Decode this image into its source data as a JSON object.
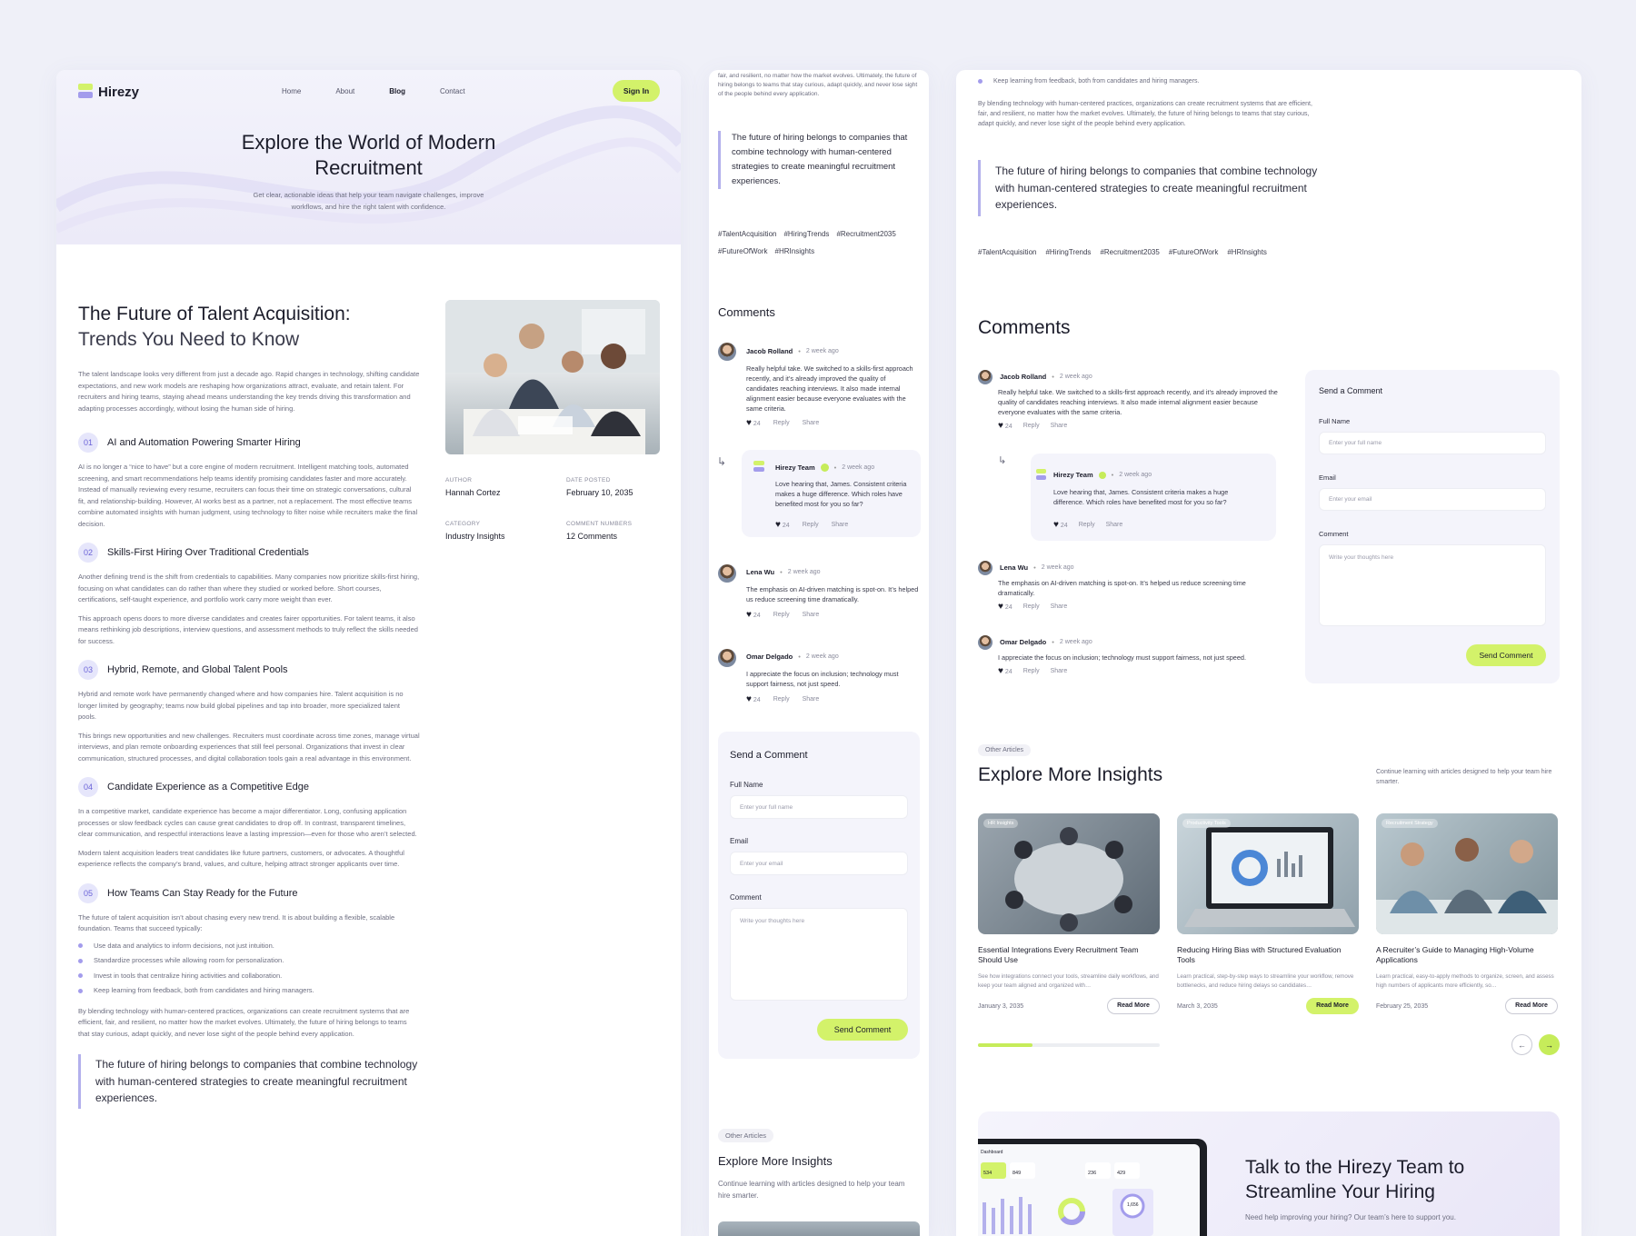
{
  "brand": {
    "name": "Hirezy",
    "colors": {
      "accent": "#d3f26a",
      "purple": "#a39cec",
      "bg": "#eff0f8"
    }
  },
  "nav": {
    "items": [
      "Home",
      "About",
      "Blog",
      "Contact"
    ],
    "active": "Blog",
    "signin": "Sign In"
  },
  "hero": {
    "title_line1": "Explore the World of Modern",
    "title_line2": "Recruitment",
    "subtitle_line1": "Get clear, actionable ideas that help your team navigate challenges, improve",
    "subtitle_line2": "workflows, and hire the right talent with confidence."
  },
  "article": {
    "title_line1": "The Future of Talent Acquisition:",
    "title_line2": "Trends You Need to Know",
    "intro": "The talent landscape looks very different from just a decade ago. Rapid changes in technology, shifting candidate expectations, and new work models are reshaping how organizations attract, evaluate, and retain talent. For recruiters and hiring teams, staying ahead means understanding the key trends driving this transformation and adapting processes accordingly, without losing the human side of hiring.",
    "meta": {
      "author_label": "AUTHOR",
      "author": "Hannah Cortez",
      "date_label": "DATE POSTED",
      "date": "February 10, 2035",
      "category_label": "CATEGORY",
      "category": "Industry Insights",
      "comments_label": "COMMENT NUMBERS",
      "comments": "12 Comments"
    },
    "sections": [
      {
        "num": "01",
        "title": "AI and Automation Powering Smarter Hiring",
        "paragraphs": [
          "AI is no longer a “nice to have” but a core engine of modern recruitment. Intelligent matching tools, automated screening, and smart recommendations help teams identify promising candidates faster and more accurately. Instead of manually reviewing every resume, recruiters can focus their time on strategic conversations, cultural fit, and relationship-building. However, AI works best as a partner, not a replacement. The most effective teams combine automated insights with human judgment, using technology to filter noise while recruiters make the final decision."
        ]
      },
      {
        "num": "02",
        "title": "Skills-First Hiring Over Traditional Credentials",
        "paragraphs": [
          "Another defining trend is the shift from credentials to capabilities. Many companies now prioritize skills-first hiring, focusing on what candidates can do rather than where they studied or worked before. Short courses, certifications, self-taught experience, and portfolio work carry more weight than ever.",
          "This approach opens doors to more diverse candidates and creates fairer opportunities. For talent teams, it also means rethinking job descriptions, interview questions, and assessment methods to truly reflect the skills needed for success."
        ]
      },
      {
        "num": "03",
        "title": "Hybrid, Remote, and Global Talent Pools",
        "paragraphs": [
          "Hybrid and remote work have permanently changed where and how companies hire. Talent acquisition is no longer limited by geography; teams now build global pipelines and tap into broader, more specialized talent pools.",
          "This brings new opportunities and new challenges. Recruiters must coordinate across time zones, manage virtual interviews, and plan remote onboarding experiences that still feel personal. Organizations that invest in clear communication, structured processes, and digital collaboration tools gain a real advantage in this environment."
        ]
      },
      {
        "num": "04",
        "title": "Candidate Experience as a Competitive Edge",
        "paragraphs": [
          "In a competitive market, candidate experience has become a major differentiator. Long, confusing application processes or slow feedback cycles can cause great candidates to drop off. In contrast, transparent timelines, clear communication, and respectful interactions leave a lasting impression—even for those who aren’t selected.",
          "Modern talent acquisition leaders treat candidates like future partners, customers, or advocates. A thoughtful experience reflects the company’s brand, values, and culture, helping attract stronger applicants over time."
        ]
      },
      {
        "num": "05",
        "title": "How Teams Can Stay Ready for the Future",
        "paragraphs": [
          "The future of talent acquisition isn’t about chasing every new trend. It is about building a flexible, scalable foundation. Teams that succeed typically:"
        ]
      }
    ],
    "bullets": [
      "Use data and analytics to inform decisions, not just intuition.",
      "Standardize processes while allowing room for personalization.",
      "Invest in tools that centralize hiring activities and collaboration.",
      "Keep learning from feedback, both from candidates and hiring managers."
    ],
    "closing": "By blending technology with human-centered practices, organizations can create recruitment systems that are efficient, fair, and resilient, no matter how the market evolves. Ultimately, the future of hiring belongs to teams that stay curious, adapt quickly, and never lose sight of the people behind every application.",
    "closing_tail": "fair, and resilient, no matter how the market evolves. Ultimately, the future of hiring belongs to teams that stay curious, adapt quickly, and never lose sight of the people behind every application.",
    "quote": "The future of hiring belongs to companies that combine technology with human-centered strategies to create meaningful recruitment experiences.",
    "tags": [
      "#TalentAcquisition",
      "#HiringTrends",
      "#Recruitment2035",
      "#FutureOfWork",
      "#HRInsights"
    ]
  },
  "comments": {
    "heading": "Comments",
    "items": [
      {
        "name": "Jacob Rolland",
        "time": "2 week ago",
        "text": "Really helpful take. We switched to a skills-first approach recently, and it’s already improved the quality of candidates reaching interviews. It also made internal alignment easier because everyone evaluates with the same criteria.",
        "likes": "24"
      },
      {
        "name": "Hirezy Team",
        "time": "2 week ago",
        "text": "Love hearing that, James. Consistent criteria makes a huge difference. Which roles have benefited most for you so far?",
        "likes": "24"
      },
      {
        "name": "Lena Wu",
        "time": "2 week ago",
        "text": "The emphasis on AI-driven matching is spot-on. It’s helped us reduce screening time dramatically.",
        "likes": "24"
      },
      {
        "name": "Omar Delgado",
        "time": "2 week ago",
        "text": "I appreciate the focus on inclusion; technology must support fairness, not just speed.",
        "likes": "24"
      }
    ],
    "reply_label": "Reply",
    "share_label": "Share"
  },
  "form": {
    "heading": "Send a Comment",
    "name_label": "Full Name",
    "name_placeholder": "Enter your full name",
    "email_label": "Email",
    "email_placeholder": "Enter your email",
    "comment_label": "Comment",
    "comment_placeholder": "Write your thoughts here",
    "submit": "Send Comment"
  },
  "more": {
    "pill": "Other Articles",
    "heading": "Explore More Insights",
    "desc": "Continue learning with articles designed to help your team hire smarter.",
    "cards": [
      {
        "chip": "HR Insights",
        "title": "Essential Integrations Every Recruitment Team Should Use",
        "desc": "See how integrations connect your tools, streamline daily workflows, and keep your team aligned and organized with…",
        "date": "January 3, 2035",
        "cta": "Read More"
      },
      {
        "chip": "Productivity Tools",
        "title": "Reducing Hiring Bias with Structured Evaluation Tools",
        "desc": "Learn practical, step-by-step ways to streamline your workflow, remove bottlenecks, and reduce hiring delays so candidates…",
        "date": "March 3, 2035",
        "cta": "Read More"
      },
      {
        "chip": "Recruitment Strategy",
        "title": "A Recruiter’s Guide to Managing High-Volume Applications",
        "desc": "Learn practical, easy-to-apply methods to organize, screen, and assess high numbers of applicants more efficiently, so…",
        "date": "February 25, 2035",
        "cta": "Read More"
      }
    ],
    "slider_progress": 0.3
  },
  "cta": {
    "title_line1": "Talk to the Hirezy Team to",
    "title_line2": "Streamline Your Hiring",
    "desc": "Need help improving your hiring? Our team’s here to support you.",
    "dash": {
      "tab": "Dashboard",
      "stat1": "534",
      "stat2": "849",
      "stat3": "236",
      "stat4": "429",
      "donut": "1,656"
    }
  }
}
